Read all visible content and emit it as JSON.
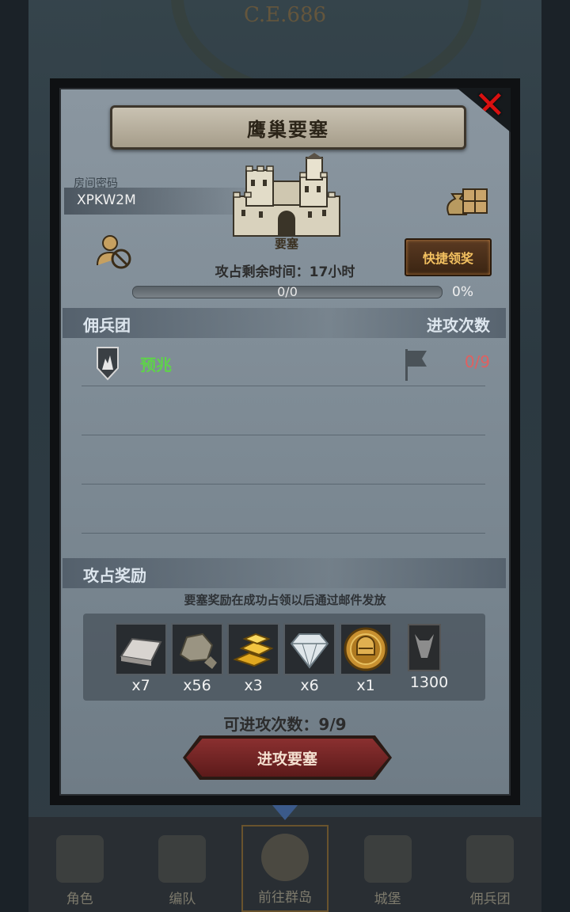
{
  "background": {
    "date_text": "C.E.686",
    "nav": [
      {
        "label": "角色",
        "icon": "knight-icon"
      },
      {
        "label": "编队",
        "icon": "helmet-icon"
      },
      {
        "label": "前往群岛",
        "icon": "compass-icon",
        "active": true
      },
      {
        "label": "城堡",
        "icon": "castle-icon"
      },
      {
        "label": "佣兵团",
        "icon": "warrior-icon"
      }
    ]
  },
  "modal": {
    "title": "鹰巢要塞",
    "close_icon": "close-icon",
    "room": {
      "label": "房间密码",
      "code": "XPKW2M"
    },
    "fortress_name": "要塞",
    "quick_claim_label": "快捷领奖",
    "time_remaining": "攻占剩余时间：17小时",
    "progress": {
      "text": "0/0",
      "percent_text": "0%",
      "value": 0
    },
    "mercenary_header": {
      "left": "佣兵团",
      "right": "进攻次数"
    },
    "mercenaries": [
      {
        "name": "预兆",
        "count": "0/9",
        "emblem": "shield-emblem-icon",
        "flag": "flag-icon"
      }
    ],
    "rewards_header": "攻占奖励",
    "reward_note": "要塞奖励在成功占领以后通过邮件发放",
    "rewards": [
      {
        "icon": "silver-ingot-icon",
        "qty": "x7"
      },
      {
        "icon": "stone-icon",
        "qty": "x56"
      },
      {
        "icon": "gold-bars-icon",
        "qty": "x3"
      },
      {
        "icon": "diamond-icon",
        "qty": "x6"
      },
      {
        "icon": "gold-helmet-coin-icon",
        "qty": "x1"
      },
      {
        "icon": "demon-banner-icon",
        "qty": "1300"
      }
    ],
    "attack_count": "可进攻次数：9/9",
    "attack_button": "进攻要塞"
  },
  "colors": {
    "merc_name": "#5fd24a",
    "merc_count": "#e06060",
    "quick_claim_text": "#f2c060",
    "close_x": "#d81010",
    "attack_button": "#8a3030"
  }
}
